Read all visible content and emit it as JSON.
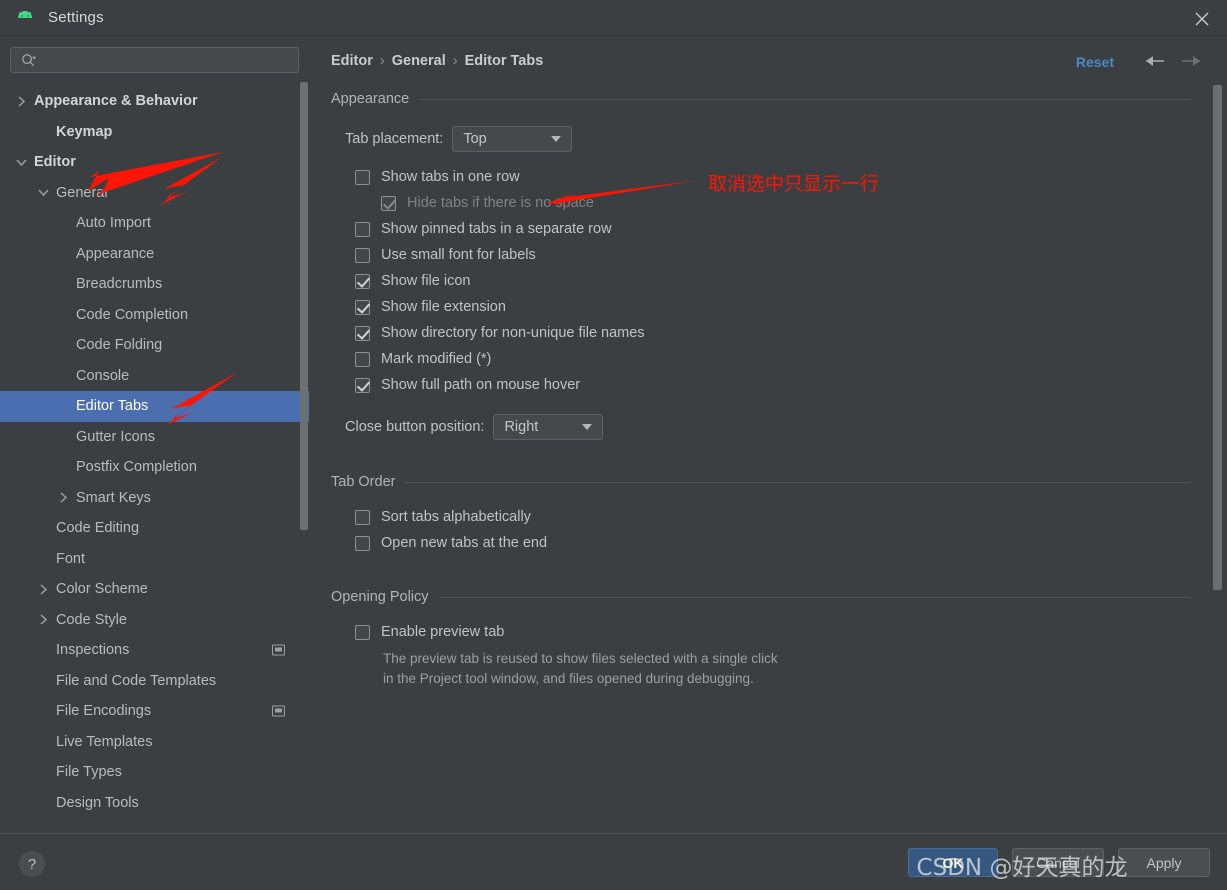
{
  "window": {
    "title": "Settings",
    "logo_icon": "android-logo-icon",
    "close_icon": "close-icon"
  },
  "search": {
    "placeholder": "",
    "value": "",
    "icon": "search-icon"
  },
  "sidebar": {
    "items": [
      {
        "label": "Appearance & Behavior",
        "indent": 0,
        "toggle": "collapsed",
        "bold": true,
        "selected": false,
        "badge": false
      },
      {
        "label": "Keymap",
        "indent": 1,
        "toggle": "none",
        "bold": true,
        "selected": false,
        "badge": false
      },
      {
        "label": "Editor",
        "indent": 0,
        "toggle": "expanded",
        "bold": true,
        "selected": false,
        "badge": false
      },
      {
        "label": "General",
        "indent": 1,
        "toggle": "expanded",
        "bold": false,
        "selected": false,
        "badge": false
      },
      {
        "label": "Auto Import",
        "indent": 2,
        "toggle": "none",
        "bold": false,
        "selected": false,
        "badge": false
      },
      {
        "label": "Appearance",
        "indent": 2,
        "toggle": "none",
        "bold": false,
        "selected": false,
        "badge": false
      },
      {
        "label": "Breadcrumbs",
        "indent": 2,
        "toggle": "none",
        "bold": false,
        "selected": false,
        "badge": false
      },
      {
        "label": "Code Completion",
        "indent": 2,
        "toggle": "none",
        "bold": false,
        "selected": false,
        "badge": false
      },
      {
        "label": "Code Folding",
        "indent": 2,
        "toggle": "none",
        "bold": false,
        "selected": false,
        "badge": false
      },
      {
        "label": "Console",
        "indent": 2,
        "toggle": "none",
        "bold": false,
        "selected": false,
        "badge": false
      },
      {
        "label": "Editor Tabs",
        "indent": 2,
        "toggle": "none",
        "bold": false,
        "selected": true,
        "badge": false
      },
      {
        "label": "Gutter Icons",
        "indent": 2,
        "toggle": "none",
        "bold": false,
        "selected": false,
        "badge": false
      },
      {
        "label": "Postfix Completion",
        "indent": 2,
        "toggle": "none",
        "bold": false,
        "selected": false,
        "badge": false
      },
      {
        "label": "Smart Keys",
        "indent": 2,
        "toggle": "collapsed",
        "bold": false,
        "selected": false,
        "badge": false
      },
      {
        "label": "Code Editing",
        "indent": 1,
        "toggle": "none",
        "bold": false,
        "selected": false,
        "badge": false
      },
      {
        "label": "Font",
        "indent": 1,
        "toggle": "none",
        "bold": false,
        "selected": false,
        "badge": false
      },
      {
        "label": "Color Scheme",
        "indent": 1,
        "toggle": "collapsed",
        "bold": false,
        "selected": false,
        "badge": false
      },
      {
        "label": "Code Style",
        "indent": 1,
        "toggle": "collapsed",
        "bold": false,
        "selected": false,
        "badge": false
      },
      {
        "label": "Inspections",
        "indent": 1,
        "toggle": "none",
        "bold": false,
        "selected": false,
        "badge": true
      },
      {
        "label": "File and Code Templates",
        "indent": 1,
        "toggle": "none",
        "bold": false,
        "selected": false,
        "badge": false
      },
      {
        "label": "File Encodings",
        "indent": 1,
        "toggle": "none",
        "bold": false,
        "selected": false,
        "badge": true
      },
      {
        "label": "Live Templates",
        "indent": 1,
        "toggle": "none",
        "bold": false,
        "selected": false,
        "badge": false
      },
      {
        "label": "File Types",
        "indent": 1,
        "toggle": "none",
        "bold": false,
        "selected": false,
        "badge": false
      },
      {
        "label": "Design Tools",
        "indent": 1,
        "toggle": "none",
        "bold": false,
        "selected": false,
        "badge": false
      }
    ]
  },
  "header": {
    "breadcrumb": [
      "Editor",
      "General",
      "Editor Tabs"
    ],
    "separator": "›",
    "reset_label": "Reset",
    "back_icon": "arrow-left-icon",
    "forward_icon": "arrow-right-icon"
  },
  "main": {
    "appearance": {
      "title": "Appearance",
      "tab_placement_label": "Tab placement:",
      "tab_placement_value": "Top",
      "checkboxes": [
        {
          "label": "Show tabs in one row",
          "checked": false,
          "disabled": false,
          "indent": false
        },
        {
          "label": "Hide tabs if there is no space",
          "checked": true,
          "disabled": true,
          "indent": true
        },
        {
          "label": "Show pinned tabs in a separate row",
          "checked": false,
          "disabled": false,
          "indent": false
        },
        {
          "label": "Use small font for labels",
          "checked": false,
          "disabled": false,
          "indent": false
        },
        {
          "label": "Show file icon",
          "checked": true,
          "disabled": false,
          "indent": false
        },
        {
          "label": "Show file extension",
          "checked": true,
          "disabled": false,
          "indent": false
        },
        {
          "label": "Show directory for non-unique file names",
          "checked": true,
          "disabled": false,
          "indent": false
        },
        {
          "label": "Mark modified (*)",
          "checked": false,
          "disabled": false,
          "indent": false
        },
        {
          "label": "Show full path on mouse hover",
          "checked": true,
          "disabled": false,
          "indent": false
        }
      ],
      "close_button_label": "Close button position:",
      "close_button_value": "Right"
    },
    "tab_order": {
      "title": "Tab Order",
      "checkboxes": [
        {
          "label": "Sort tabs alphabetically",
          "checked": false
        },
        {
          "label": "Open new tabs at the end",
          "checked": false
        }
      ]
    },
    "opening_policy": {
      "title": "Opening Policy",
      "checkboxes": [
        {
          "label": "Enable preview tab",
          "checked": false
        }
      ],
      "hint_line1": "The preview tab is reused to show files selected with a single click",
      "hint_line2": "in the Project tool window, and files opened during debugging."
    }
  },
  "footer": {
    "help_label": "?",
    "ok_label": "OK",
    "cancel_label": "Cancel",
    "apply_label": "Apply"
  },
  "annotations": {
    "note_text": "取消选中只显示一行",
    "watermark": "CSDN @好天真的龙",
    "color": "#fc1505"
  }
}
